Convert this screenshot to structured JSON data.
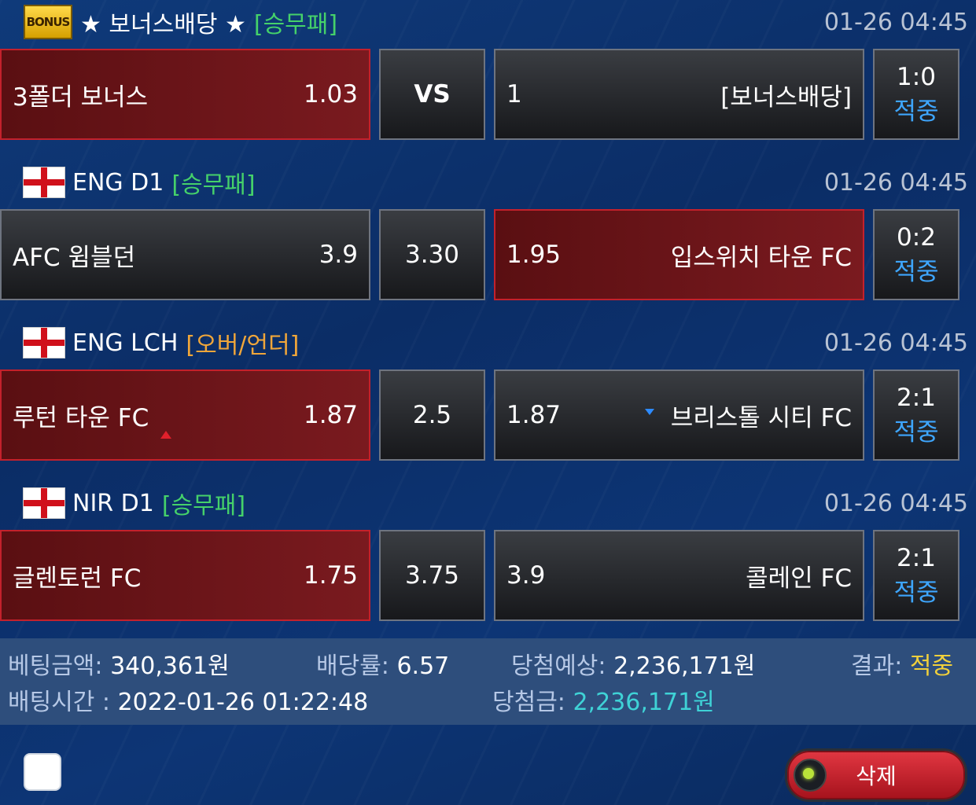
{
  "bets": [
    {
      "league": "★ 보너스배당 ★",
      "market": "[승무패]",
      "time": "01-26 04:45",
      "home": {
        "name": "3폴더 보너스",
        "odds": "1.03"
      },
      "mid": "VS",
      "away": {
        "odds": "1",
        "name": "[보너스배당]"
      },
      "score": "1:0",
      "status": "적중"
    },
    {
      "league": "ENG D1",
      "market": "[승무패]",
      "time": "01-26 04:45",
      "home": {
        "name": "AFC 윔블던",
        "odds": "3.9"
      },
      "mid": "3.30",
      "away": {
        "odds": "1.95",
        "name": "입스위치 타운 FC"
      },
      "score": "0:2",
      "status": "적중"
    },
    {
      "league": "ENG LCH",
      "market": "[오버/언더]",
      "time": "01-26 04:45",
      "home": {
        "name": "루턴 타운 FC",
        "odds": "1.87"
      },
      "mid": "2.5",
      "away": {
        "odds": "1.87",
        "name": "브리스톨 시티 FC"
      },
      "score": "2:1",
      "status": "적중"
    },
    {
      "league": "NIR D1",
      "market": "[승무패]",
      "time": "01-26 04:45",
      "home": {
        "name": "글렌토런 FC",
        "odds": "1.75"
      },
      "mid": "3.75",
      "away": {
        "odds": "3.9",
        "name": "콜레인 FC"
      },
      "score": "2:1",
      "status": "적중"
    }
  ],
  "bonus_badge": "BONUS",
  "summary": {
    "amount_label": "베팅금액:",
    "amount": "340,361원",
    "odds_label": "배당률:",
    "odds": "6.57",
    "expected_label": "당첨예상:",
    "expected": "2,236,171원",
    "result_label": "결과:",
    "result": "적중",
    "time_label": "배팅시간 :",
    "time": "2022-01-26 01:22:48",
    "win_label": "당첨금:",
    "win": "2,236,171원"
  },
  "delete_label": "삭제"
}
